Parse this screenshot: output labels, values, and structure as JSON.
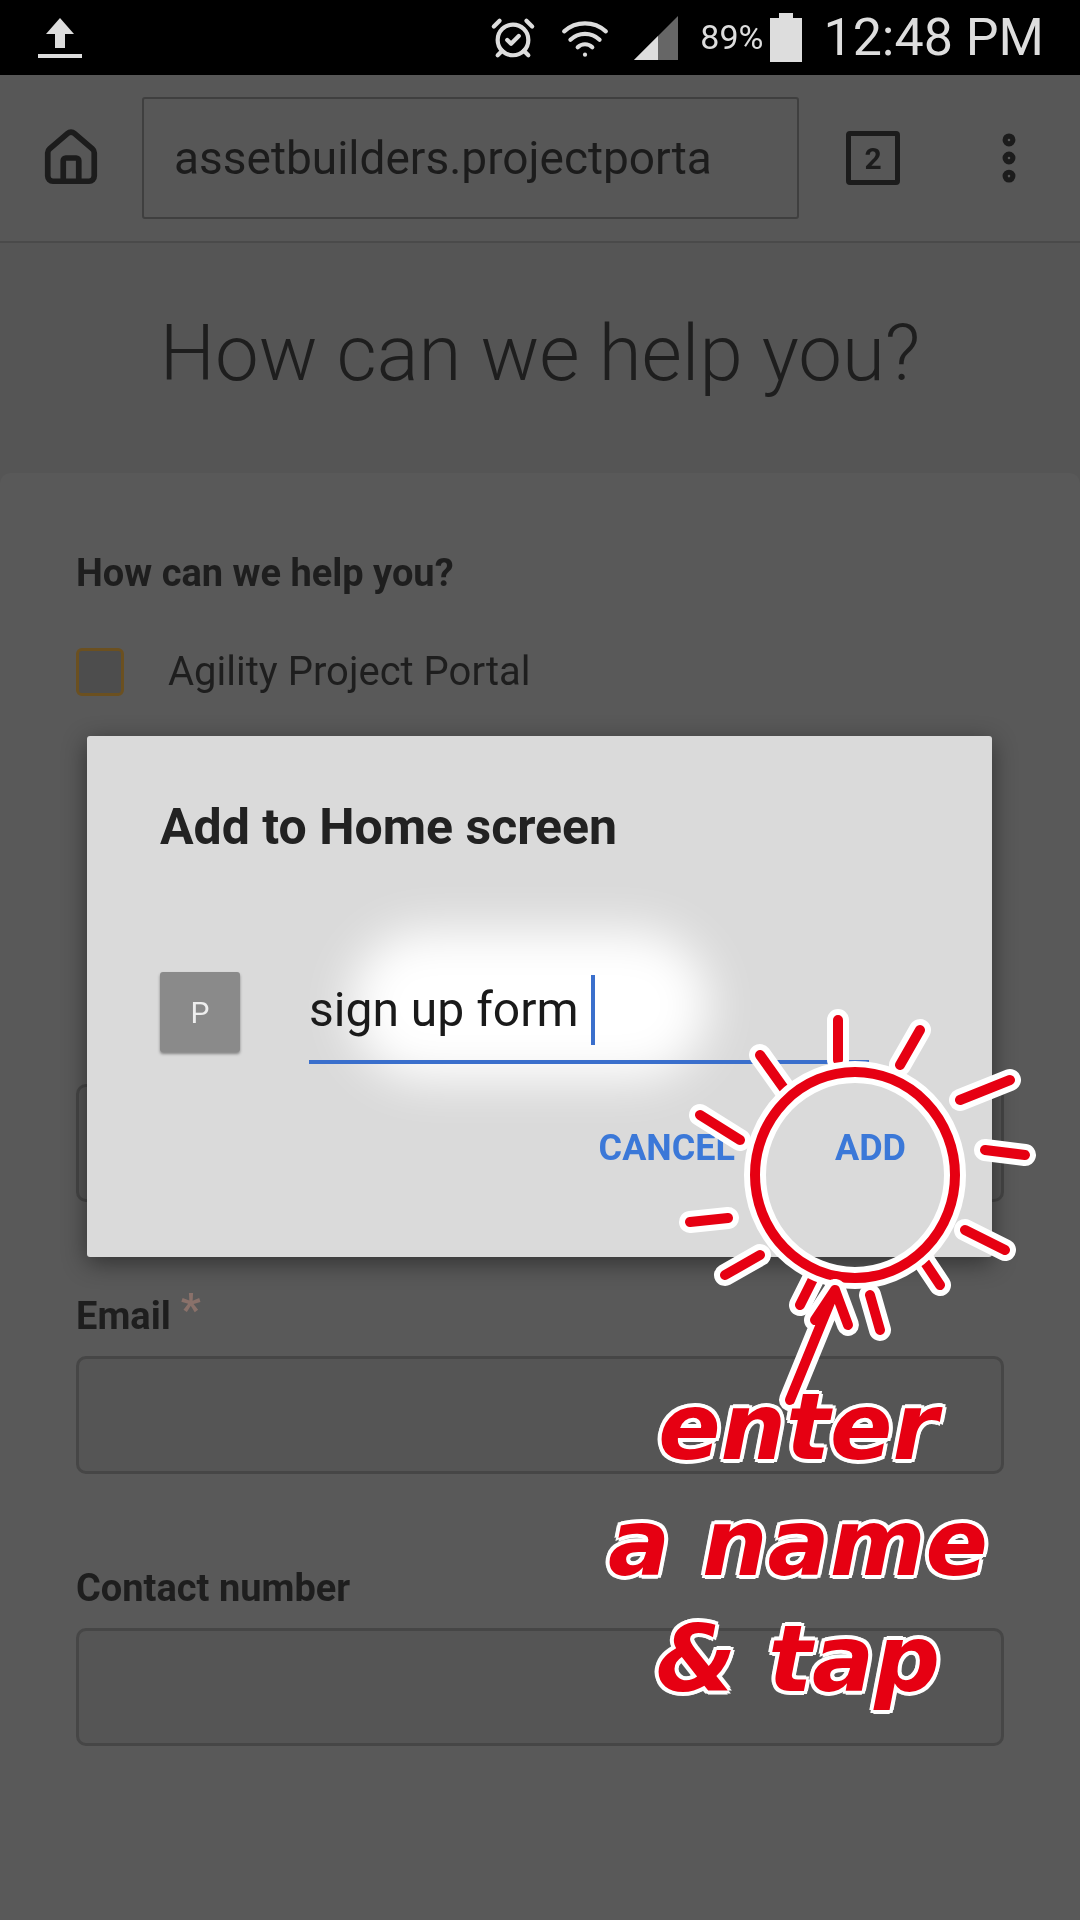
{
  "status_bar": {
    "battery": "89%",
    "time": "12:48 PM"
  },
  "browser": {
    "url": "assetbuilders.projectporta",
    "tab_count": "2"
  },
  "page": {
    "title": "How can we help you?",
    "question": "How can we help you?",
    "options": [
      {
        "label": "Agility Project Portal",
        "checked": false
      }
    ],
    "fields": [
      {
        "kind": "text"
      },
      {
        "kind": "text",
        "label": "Email",
        "required_mark": "*"
      },
      {
        "kind": "text",
        "label": "Contact number"
      }
    ]
  },
  "dialog": {
    "title": "Add to Home screen",
    "icon_letter": "P",
    "name_value": "sign up form",
    "buttons": [
      "CANCEL",
      "ADD"
    ]
  },
  "annotation": {
    "lines": [
      "enter",
      "a name",
      "& tap"
    ]
  }
}
